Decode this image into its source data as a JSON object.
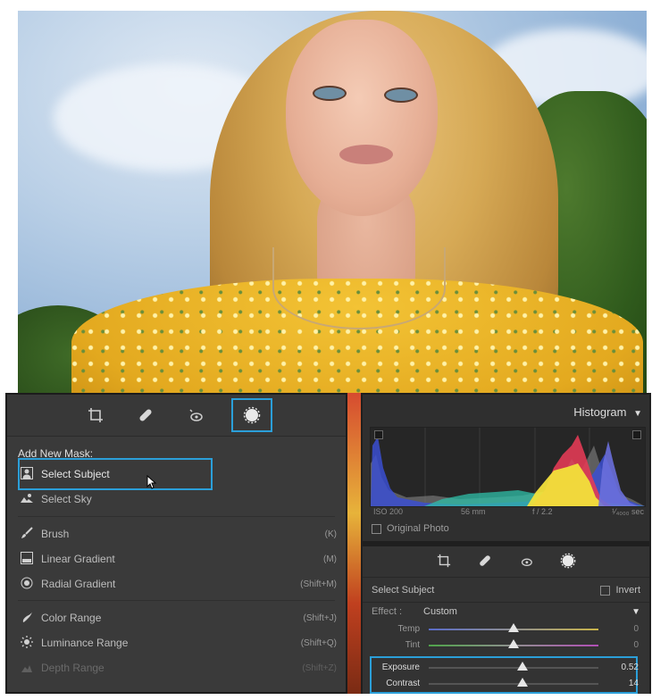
{
  "photo": {
    "icon": "portrait-photo"
  },
  "masking_panel": {
    "toolbar": {
      "icons": [
        "crop-icon",
        "healing-icon",
        "red-eye-icon",
        "masking-icon"
      ],
      "active_index": 3
    },
    "title": "Add New Mask:",
    "items": [
      {
        "label": "Select Subject",
        "icon": "subject-icon",
        "shortcut": "",
        "dimmed": false,
        "highlighted": true
      },
      {
        "label": "Select Sky",
        "icon": "sky-icon",
        "shortcut": "",
        "dimmed": false,
        "highlighted": false
      },
      {
        "label": "Brush",
        "icon": "brush-icon",
        "shortcut": "(K)",
        "dimmed": false,
        "highlighted": false
      },
      {
        "label": "Linear Gradient",
        "icon": "linear-gradient-icon",
        "shortcut": "(M)",
        "dimmed": false,
        "highlighted": false
      },
      {
        "label": "Radial Gradient",
        "icon": "radial-gradient-icon",
        "shortcut": "(Shift+M)",
        "dimmed": false,
        "highlighted": false
      },
      {
        "label": "Color Range",
        "icon": "color-range-icon",
        "shortcut": "(Shift+J)",
        "dimmed": false,
        "highlighted": false
      },
      {
        "label": "Luminance Range",
        "icon": "luminance-range-icon",
        "shortcut": "(Shift+Q)",
        "dimmed": false,
        "highlighted": false
      },
      {
        "label": "Depth Range",
        "icon": "depth-range-icon",
        "shortcut": "(Shift+Z)",
        "dimmed": true,
        "highlighted": false
      }
    ]
  },
  "histogram": {
    "title": "Histogram",
    "meta": {
      "iso": "ISO 200",
      "focal": "56 mm",
      "aperture": "f / 2.2",
      "shutter": "¹⁄₄₀₀₀ sec"
    },
    "original_photo_label": "Original Photo"
  },
  "mask_settings": {
    "toolbar_icons": [
      "crop-icon",
      "healing-icon",
      "red-eye-icon",
      "masking-icon"
    ],
    "mask_name": "Select Subject",
    "invert_label": "Invert",
    "effect_label": "Effect :",
    "effect_value": "Custom",
    "sliders": [
      {
        "label": "Temp",
        "value": "0",
        "position": 0.5,
        "highlighted": false
      },
      {
        "label": "Tint",
        "value": "0",
        "position": 0.5,
        "highlighted": false
      },
      {
        "label": "Exposure",
        "value": "0.52",
        "position": 0.55,
        "highlighted": true
      },
      {
        "label": "Contrast",
        "value": "14",
        "position": 0.55,
        "highlighted": true
      }
    ]
  },
  "colors": {
    "accent": "#2b9fd9",
    "panel_bg": "#3a3a3a"
  }
}
